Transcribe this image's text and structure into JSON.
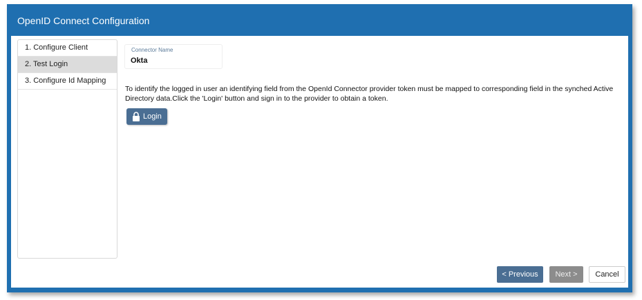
{
  "dialog": {
    "title": "OpenID Connect Configuration"
  },
  "steps": [
    {
      "label": "1. Configure Client",
      "active": false
    },
    {
      "label": "2. Test Login",
      "active": true
    },
    {
      "label": "3. Configure Id Mapping",
      "active": false
    }
  ],
  "connector": {
    "label": "Connector Name",
    "value": "Okta"
  },
  "instruction": "To identify the logged in user an identifying field from the OpenId Connector provider token must be mapped to corresponding field in the synched Active Directory data.Click the 'Login' button and sign in to the provider to obtain a token.",
  "login_button": {
    "label": "Login",
    "icon": "lock-icon"
  },
  "footer": {
    "previous_label": "< Previous",
    "next_label": "Next >",
    "cancel_label": "Cancel"
  },
  "colors": {
    "header": "#1f6fb0",
    "primary_button": "#4a6e93",
    "disabled_button": "#8c8c8c",
    "active_step": "#dcdcdc"
  }
}
